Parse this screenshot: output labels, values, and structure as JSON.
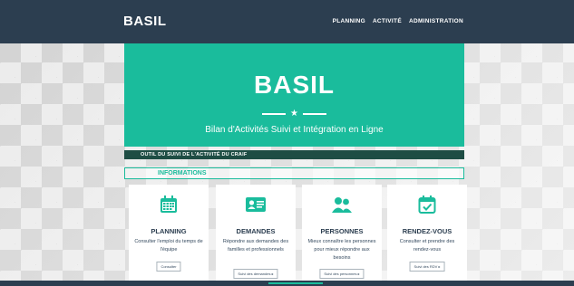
{
  "navbar": {
    "brand": "BASIL",
    "links": [
      "PLANNING",
      "ACTIVITÉ",
      "ADMINISTRATION"
    ]
  },
  "hero": {
    "title": "BASIL",
    "subtitle": "Bilan d'Activités Suivi et Intégration en Ligne"
  },
  "section": {
    "header": "OUTIL DU SUIVI DE L'ACTIVITÉ DU CRAIF",
    "info_label": "INFORMATIONS"
  },
  "cards": [
    {
      "icon": "calendar-icon",
      "title": "PLANNING",
      "description": "Consulter l'emploi du temps de l'équipe",
      "button": "Consulter"
    },
    {
      "icon": "id-card-icon",
      "title": "DEMANDES",
      "description": "Répondre aux demandes des familles et professionnels",
      "button": "Suivi des demandes"
    },
    {
      "icon": "people-icon",
      "title": "PERSONNES",
      "description": "Mieux connaître les personnes pour mieux répondre aux besoins",
      "button": "Suivi des personnes"
    },
    {
      "icon": "calendar-check-icon",
      "title": "RENDEZ-VOUS",
      "description": "Consulter et prendre des rendez-vous",
      "button": "Suivi des RDV"
    }
  ],
  "colors": {
    "navbar": "#2c3e50",
    "accent": "#1abc9c",
    "section_header": "#1e4d44"
  }
}
